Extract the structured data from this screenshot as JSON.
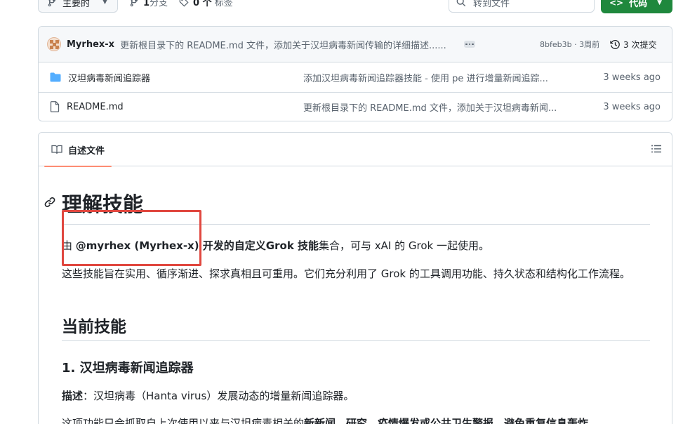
{
  "toolbar": {
    "branch_label": "主要的",
    "branches_count": "1",
    "branches_label": "分支",
    "tags_count": "0 个",
    "tags_label": "标签",
    "search_placeholder": "转到文件",
    "code_button": "代码"
  },
  "latest_commit": {
    "author": "Myrhex-x",
    "message": "更新根目录下的 README.md 文件，添加关于汉坦病毒新闻传输的详细描述......",
    "hash_time": "8bfeb3b · 3周前",
    "commit_count": "3 次提交"
  },
  "files": [
    {
      "name": "汉坦病毒新闻追踪器",
      "type": "folder",
      "message": "添加汉坦病毒新闻追踪器技能 - 使用 pe 进行增量新闻追踪...",
      "time": "3 weeks ago"
    },
    {
      "name": "README.md",
      "type": "file",
      "message": "更新根目录下的 README.md 文件，添加关于汉坦病毒新闻...",
      "time": "3 weeks ago"
    }
  ],
  "readme": {
    "tab_label": "自述文件",
    "h1": "理解技能",
    "p1_prefix": "由 ",
    "p1_bold": "@myrhex (Myrhex-x) 开发的自定义Grok 技能",
    "p1_suffix": "集合，可与 xAI 的 Grok 一起使用。",
    "p2": "这些技能旨在实用、循序渐进、探求真相且可重用。它们充分利用了 Grok 的工具调用功能、持久状态和结构化工作流程。",
    "h2": "当前技能",
    "h3": "1. 汉坦病毒新闻追踪器",
    "p3_label": "描述",
    "p3_text": "：汉坦病毒（Hanta virus）发展动态的增量新闻追踪器。",
    "p4_prefix": "这项功能只会抓取自上次使用以来与汉坦病毒相关的",
    "p4_bold": "新新闻、研究、疫情爆发或公共卫生警报，避免重复信息轰炸"
  },
  "colors": {
    "accent_green": "#1f883d",
    "highlight_red": "#e0473f",
    "tab_underline": "#fd8c73",
    "folder_blue": "#54aeff"
  }
}
